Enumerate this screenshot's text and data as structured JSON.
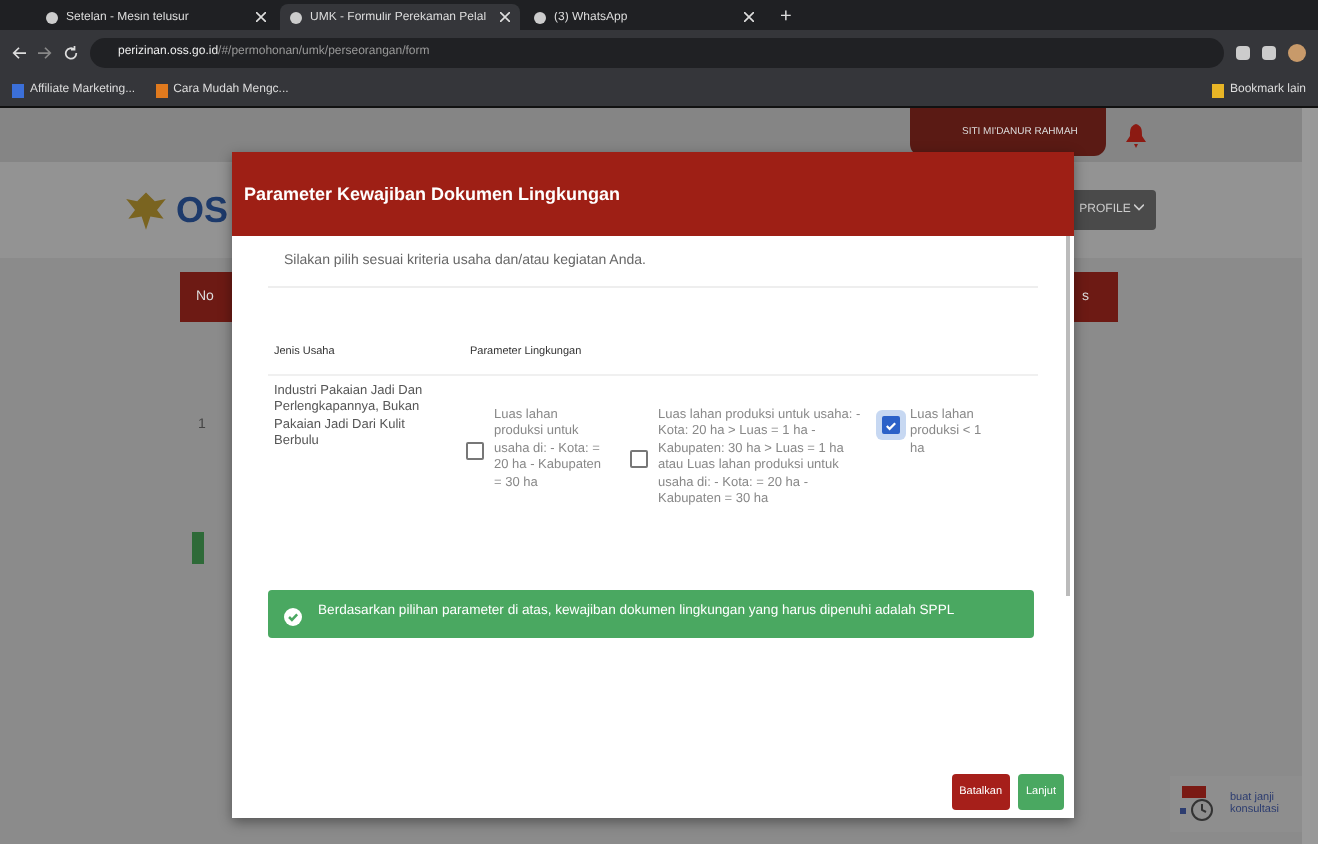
{
  "browser": {
    "tabs": [
      {
        "title": "Setelan - Mesin telusur",
        "selected": false
      },
      {
        "title": "UMK - Formulir Perekaman Pelal",
        "selected": true
      },
      {
        "title": "(3) WhatsApp",
        "selected": false
      }
    ],
    "new_tab": "+",
    "address": {
      "domain": "perizinan.oss.go.id",
      "path": "/#/permohonan/umk/perseorangan/form"
    },
    "bookmarks": [
      "Affiliate Marketing...",
      "Cara Mudah Mengc..."
    ],
    "other_bookmarks": "Bookmark lain"
  },
  "page": {
    "user_button": "SITI MI'DANUR RAHMAH",
    "logo": "OS",
    "profile_button": "PROFILE",
    "table_header": [
      "No",
      "s"
    ],
    "row_number": "1"
  },
  "modal": {
    "title": "Parameter Kewajiban Dokumen Lingkungan",
    "instruction": "Silakan pilih sesuai kriteria usaha dan/atau kegiatan Anda.",
    "columns": [
      "Jenis Usaha",
      "Parameter Lingkungan"
    ],
    "business": "Industri Pakaian Jadi Dan Perlengkapannya, Bukan Pakaian Jadi Dari Kulit Berbulu",
    "options": [
      {
        "label": "Luas lahan produksi untuk usaha di: - Kota: = 20 ha - Kabupaten = 30 ha",
        "checked": false
      },
      {
        "label": "Luas lahan produksi untuk usaha: - Kota: 20 ha > Luas = 1 ha - Kabupaten: 30 ha > Luas = 1 ha atau Luas lahan produksi untuk usaha di: - Kota: = 20 ha - Kabupaten = 30 ha",
        "checked": false
      },
      {
        "label": "Luas lahan produksi < 1 ha",
        "checked": true
      }
    ],
    "result": "Berdasarkan pilihan parameter di atas, kewajiban dokumen lingkungan yang harus dipenuhi adalah SPPL",
    "buttons": [
      {
        "label": "Batalkan",
        "kind": "cancel"
      },
      {
        "label": "Lanjut",
        "kind": "primary"
      }
    ]
  },
  "widget": {
    "label": "buat janji konsultasi"
  }
}
